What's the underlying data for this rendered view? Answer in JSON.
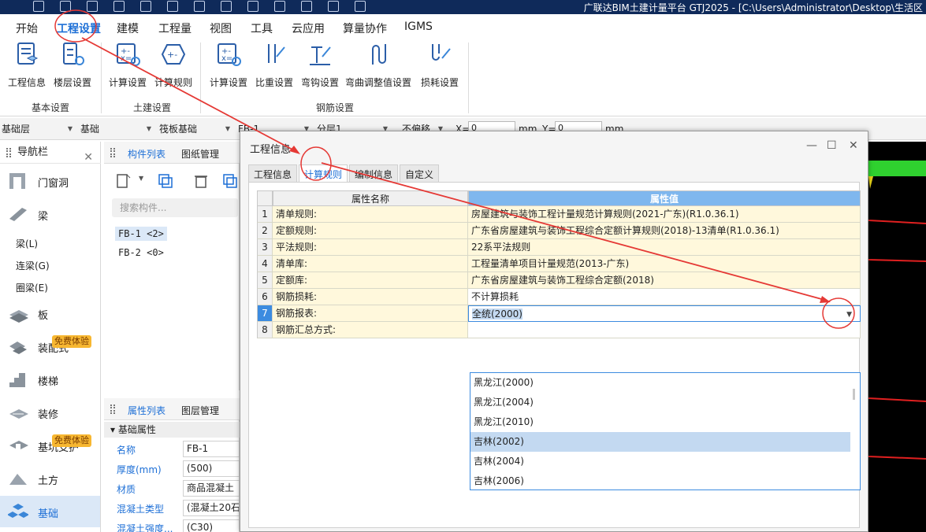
{
  "title_bar": {
    "title": "广联达BIM土建计量平台 GTJ2025 - [C:\\Users\\Administrator\\Desktop\\生活区"
  },
  "menu": {
    "tabs": [
      "开始",
      "工程设置",
      "建模",
      "工程量",
      "视图",
      "工具",
      "云应用",
      "算量协作",
      "IGMS"
    ],
    "active": "工程设置"
  },
  "ribbon": {
    "basic": {
      "label": "基本设置",
      "buttons": [
        "工程信息",
        "楼层设置"
      ]
    },
    "civil": {
      "label": "土建设置",
      "buttons": [
        "计算设置",
        "计算规则"
      ]
    },
    "rebar": {
      "label": "钢筋设置",
      "buttons": [
        "计算设置",
        "比重设置",
        "弯钩设置",
        "弯曲调整值设置",
        "损耗设置"
      ]
    }
  },
  "filterbar": {
    "floor": "基础层",
    "category": "基础",
    "type": "筏板基础",
    "component": "FB-1",
    "layer": "分层1",
    "offset": "不偏移",
    "x_label": "X=",
    "x_value": "0",
    "y_label": "Y=",
    "y_value": "0",
    "unit": "mm"
  },
  "nav": {
    "title": "导航栏",
    "items": [
      {
        "label": "门窗洞",
        "icon": "door-window-icon"
      },
      {
        "label": "梁",
        "icon": "beam-icon"
      },
      {
        "label": "板",
        "icon": "slab-icon"
      },
      {
        "label": "装配式",
        "icon": "prefab-icon"
      },
      {
        "label": "楼梯",
        "icon": "stair-icon"
      },
      {
        "label": "装修",
        "icon": "decoration-icon"
      },
      {
        "label": "基坑支护",
        "icon": "foundation-pit-icon"
      },
      {
        "label": "土方",
        "icon": "earthwork-icon"
      },
      {
        "label": "基础",
        "icon": "foundation-icon"
      }
    ],
    "beam_subitems": [
      "梁(L)",
      "连梁(G)",
      "圈梁(E)"
    ],
    "free_badge": "免费体验"
  },
  "component_panel": {
    "tabs": [
      "构件列表",
      "图纸管理"
    ],
    "search_placeholder": "搜索构件...",
    "items": [
      "FB-1 <2>",
      "FB-2 <0>"
    ]
  },
  "property_panel": {
    "tabs": [
      "属性列表",
      "图层管理"
    ],
    "group": "基础属性",
    "rows": [
      {
        "key": "名称",
        "value": "FB-1"
      },
      {
        "key": "厚度(mm)",
        "value": "(500)"
      },
      {
        "key": "材质",
        "value": "商品混凝土"
      },
      {
        "key": "混凝土类型",
        "value": "(混凝土20石"
      },
      {
        "key": "混凝土强度...",
        "value": "(C30)"
      }
    ]
  },
  "dialog": {
    "title": "工程信息",
    "tabs": [
      "工程信息",
      "计算规则",
      "编制信息",
      "自定义"
    ],
    "active_tab": "计算规则",
    "col_name": "属性名称",
    "col_value": "属性值",
    "rows": [
      {
        "num": "1",
        "key": "清单规则:",
        "value": "房屋建筑与装饰工程计量规范计算规则(2021-广东)(R1.0.36.1)"
      },
      {
        "num": "2",
        "key": "定额规则:",
        "value": "广东省房屋建筑与装饰工程综合定额计算规则(2018)-13清单(R1.0.36.1)"
      },
      {
        "num": "3",
        "key": "平法规则:",
        "value": "22系平法规则"
      },
      {
        "num": "4",
        "key": "清单库:",
        "value": "工程量清单项目计量规范(2013-广东)"
      },
      {
        "num": "5",
        "key": "定额库:",
        "value": "广东省房屋建筑与装饰工程综合定额(2018)"
      },
      {
        "num": "6",
        "key": "钢筋损耗:",
        "value": "不计算损耗"
      },
      {
        "num": "7",
        "key": "钢筋报表:",
        "value": "全统(2000)"
      },
      {
        "num": "8",
        "key": "钢筋汇总方式:",
        "value": ""
      }
    ],
    "dropdown_options": [
      "黑龙江(2000)",
      "黑龙江(2004)",
      "黑龙江(2010)",
      "吉林(2002)",
      "吉林(2004)",
      "吉林(2006)"
    ],
    "highlighted_option": "吉林(2002)"
  },
  "colors": {
    "accent": "#1d6fd6",
    "annotation": "#e53935",
    "header_blue": "#7fb7ee",
    "row_yellow": "#fff8dc"
  }
}
